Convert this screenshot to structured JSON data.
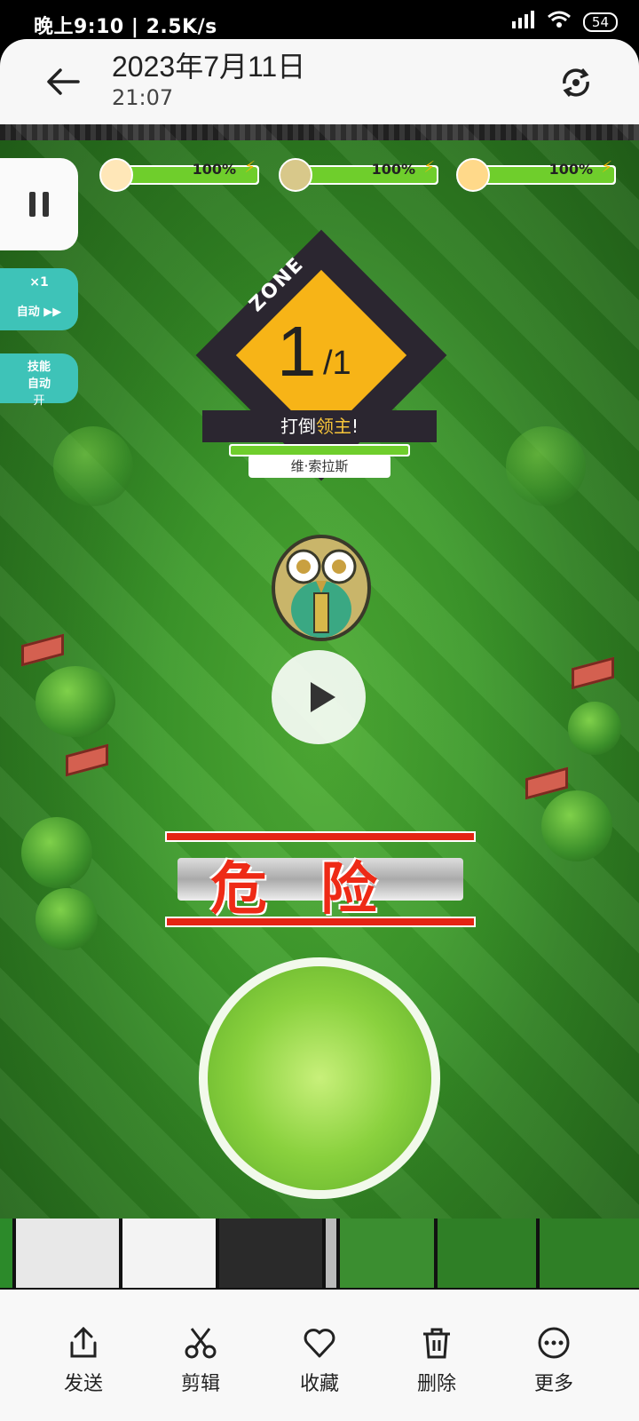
{
  "status_bar": {
    "left_text": "晚上9:10 | 2.5K/s",
    "battery": "54"
  },
  "header": {
    "title": "2023年7月11日",
    "time": "21:07",
    "back_icon": "arrow-left-icon",
    "rotate_icon": "rotate-icon"
  },
  "game": {
    "hp_bars": [
      {
        "percent_label": "100%",
        "fill": 1.0
      },
      {
        "percent_label": "100%",
        "fill": 1.0
      },
      {
        "percent_label": "100%",
        "fill": 1.0
      }
    ],
    "auto_attack": {
      "multiplier": "×1",
      "label": "自动 ▶▶"
    },
    "skill_auto": {
      "line1": "技能",
      "line2": "自动",
      "state": "开"
    },
    "zone": {
      "label": "ZONE",
      "current": "1",
      "total": "/1"
    },
    "objective": {
      "prefix": "打倒",
      "highlight": "领主",
      "suffix": "!"
    },
    "boss_name": "维·索拉斯",
    "warning": "危险"
  },
  "toolbar": {
    "send": "发送",
    "edit": "剪辑",
    "favorite": "收藏",
    "delete": "删除",
    "more": "更多"
  }
}
